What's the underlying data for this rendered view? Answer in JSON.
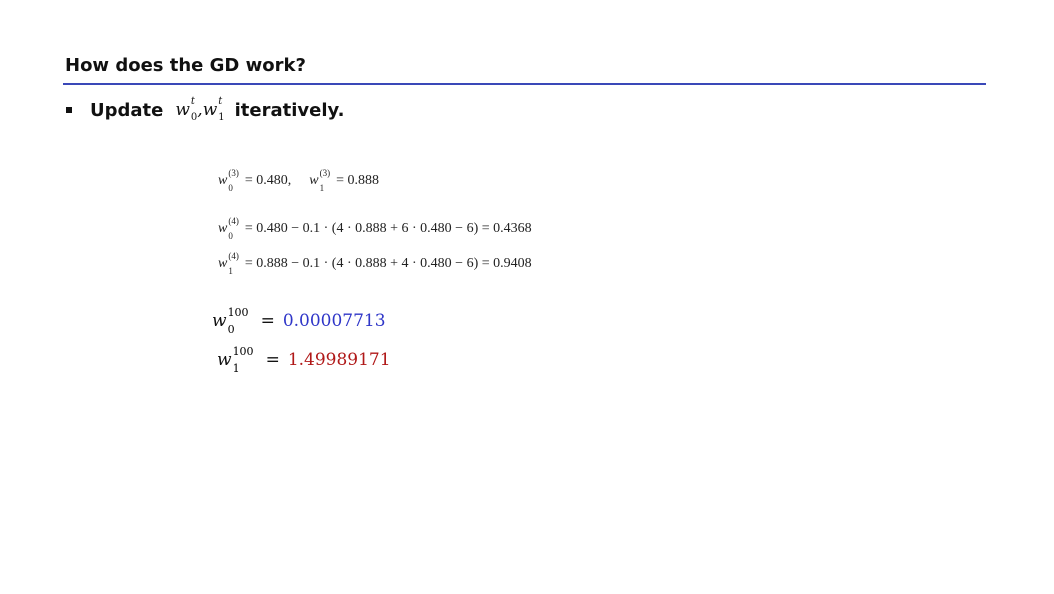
{
  "slide": {
    "title": "How does the GD work?",
    "bullet": {
      "pre": "Update",
      "var": "w",
      "sup": "t",
      "sub0": "0",
      "sub1": "1",
      "comma": ",",
      "post": "iteratively."
    },
    "equations": {
      "line1": {
        "w0_sup": "(3)",
        "w0_sub": "0",
        "w0_rhs": "= 0.480,",
        "w1_sup": "(3)",
        "w1_sub": "1",
        "w1_rhs": "= 0.888"
      },
      "line2": {
        "sup": "(4)",
        "sub": "0",
        "rhs": "= 0.480 − 0.1 · (4 · 0.888 + 6 · 0.480 − 6) = 0.4368"
      },
      "line3": {
        "sup": "(4)",
        "sub": "1",
        "rhs": "= 0.888 − 0.1 · (4 · 0.888 + 4 · 0.480 − 6) = 0.9408"
      }
    },
    "results": {
      "w0": {
        "sup": "100",
        "sub": "0",
        "eq": "=",
        "value": "0.00007713"
      },
      "w1": {
        "sup": "100",
        "sub": "1",
        "eq": "=",
        "value": "1.49989171"
      }
    },
    "colors": {
      "rule": "#3a48b8",
      "w0_value": "#2f36c8",
      "w1_value": "#b01818"
    }
  }
}
